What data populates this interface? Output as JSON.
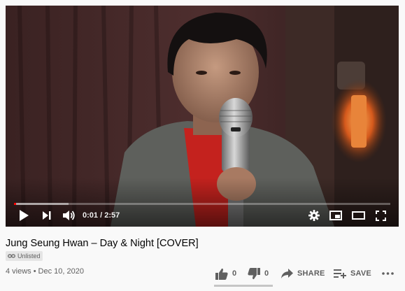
{
  "player": {
    "progress_fraction": 0.0058,
    "buffered_fraction": 0.145,
    "time_current": "0:01",
    "time_separator": "/",
    "time_duration": "2:57",
    "icons": {
      "play": "play-icon",
      "next": "skip-next-icon",
      "volume": "volume-icon",
      "settings": "gear-icon",
      "miniplayer": "miniplayer-icon",
      "theater": "theater-mode-icon",
      "fullscreen": "fullscreen-icon"
    },
    "colors": {
      "progress": "#ff0000"
    }
  },
  "video": {
    "title": "Jung Seung Hwan – Day & Night [COVER]",
    "visibility_label": "Unlisted",
    "views": "4 views",
    "date": "Dec 10, 2020"
  },
  "actions": {
    "like_count": "0",
    "dislike_count": "0",
    "share_label": "SHARE",
    "save_label": "SAVE"
  }
}
